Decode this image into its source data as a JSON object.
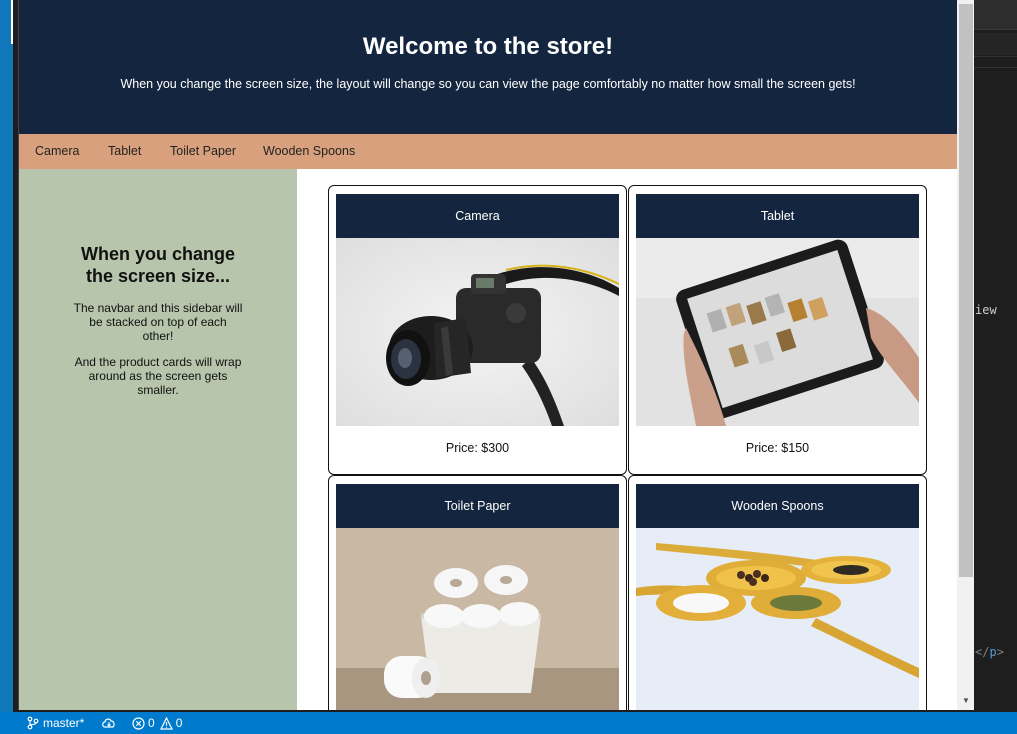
{
  "site": {
    "title": "Welcome to the store!",
    "subtitle": "When you change the screen size, the layout will change so you can view the page comfortably no matter how small the screen gets!"
  },
  "navbar": {
    "items": [
      {
        "label": "Camera"
      },
      {
        "label": "Tablet"
      },
      {
        "label": "Toilet Paper"
      },
      {
        "label": "Wooden Spoons"
      }
    ]
  },
  "sidebar": {
    "title": "When you change the screen size...",
    "paragraph1": "The navbar and this sidebar will be stacked on top of each other!",
    "paragraph2": "And the product cards will wrap around as the screen gets smaller."
  },
  "products": [
    {
      "name": "Camera",
      "price": "Price: $300",
      "image": "camera-photo"
    },
    {
      "name": "Tablet",
      "price": "Price: $150",
      "image": "tablet-photo"
    },
    {
      "name": "Toilet Paper",
      "price": "",
      "image": "toilet-paper-photo"
    },
    {
      "name": "Wooden Spoons",
      "price": "",
      "image": "wooden-spoons-photo"
    }
  ],
  "editor": {
    "fragment_top": "iew",
    "fragment_bottom_open": "</",
    "fragment_bottom_tag": "p",
    "fragment_bottom_close": ">"
  },
  "statusbar": {
    "branch": "master*",
    "errors": "0",
    "warnings": "0",
    "icons": [
      "source-control-icon",
      "sync-cloud-icon",
      "error-icon",
      "warning-icon"
    ]
  },
  "colors": {
    "header_bg": "#14263f",
    "navbar_bg": "#d8a07c",
    "sidebar_bg": "#b6c5ab",
    "statusbar_bg": "#007acc"
  }
}
